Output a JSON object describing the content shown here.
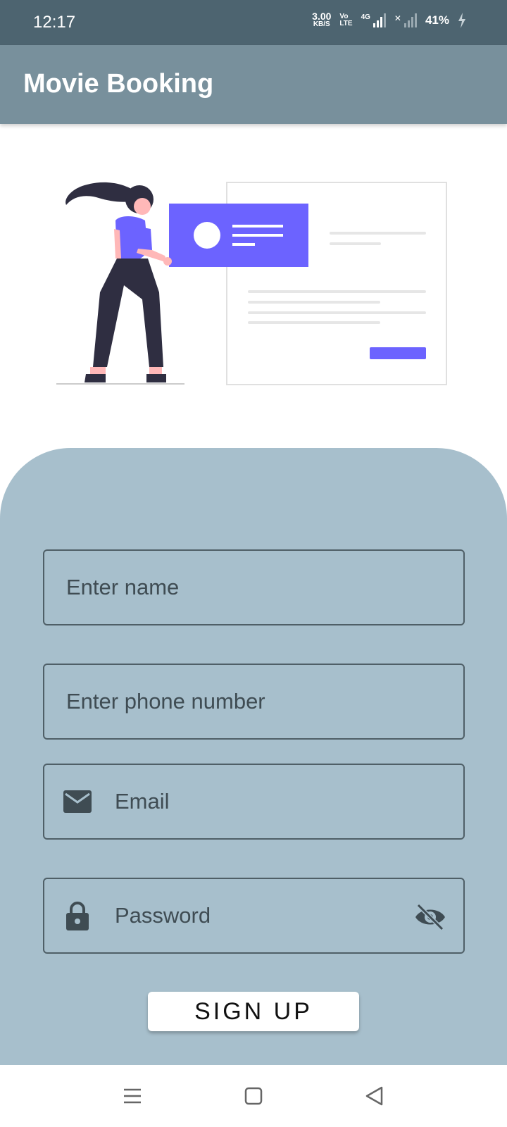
{
  "status_bar": {
    "time": "12:17",
    "net_speed": "3.00",
    "net_speed_unit": "KB/S",
    "volte_top": "Vo",
    "volte_bottom": "LTE",
    "network_type": "4G",
    "battery": "41%"
  },
  "app_bar": {
    "title": "Movie Booking"
  },
  "illustration": {
    "name": "sign-up-illustration",
    "accent_color": "#6c63ff"
  },
  "form": {
    "name_placeholder": "Enter name",
    "phone_placeholder": "Enter phone number",
    "email_placeholder": "Email",
    "password_placeholder": "Password",
    "signup_label": "SIGN UP"
  },
  "nav": {
    "icons": [
      "menu-icon",
      "home-icon",
      "back-icon"
    ]
  },
  "colors": {
    "status_bar": "#4d6470",
    "app_bar": "#78909c",
    "form_panel": "#a7bfcc",
    "field_border": "#4f5f67"
  }
}
